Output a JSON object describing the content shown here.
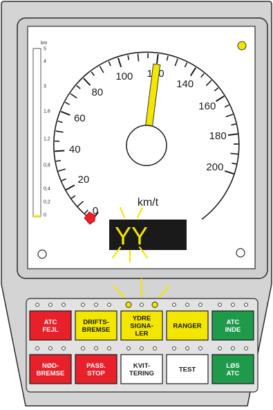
{
  "colors": {
    "panel": "#d4d4d4",
    "screen_bg": "#ffffff",
    "needle": "#f3e600",
    "red": "#e8202a",
    "yellow": "#f3e600",
    "green": "#1f9a4a",
    "white": "#ffffff",
    "display": "#1a1a1a",
    "indicator_glow": "#f3e600"
  },
  "distance_scale": {
    "unit": "km",
    "labels": [
      "5",
      "4",
      "3",
      "1,6",
      "1,2",
      "0,8",
      "0,4",
      "0,2",
      "0"
    ]
  },
  "speedometer": {
    "unit": "km/t",
    "current_speed": 120,
    "min": 0,
    "max": 200,
    "labels": [
      "0",
      "20",
      "40",
      "60",
      "80",
      "100",
      "120",
      "140",
      "160",
      "180",
      "200"
    ]
  },
  "signal_display": {
    "text": "YY"
  },
  "status_lamp": {
    "color": "yellow",
    "state": "on"
  },
  "buttons_row1": [
    {
      "id": "atc-fejl",
      "lines": [
        "ATC",
        "FEJL"
      ],
      "color": "red"
    },
    {
      "id": "driftsbremse",
      "lines": [
        "DRIFTS-",
        "BREMSE"
      ],
      "color": "yellow"
    },
    {
      "id": "ydre-signaler",
      "lines": [
        "YDRE",
        "SIGNA-",
        "LER"
      ],
      "color": "yellow"
    },
    {
      "id": "ranger",
      "lines": [
        "RANGER"
      ],
      "color": "yellow"
    },
    {
      "id": "atc-inde",
      "lines": [
        "ATC",
        "INDE"
      ],
      "color": "green"
    }
  ],
  "buttons_row2": [
    {
      "id": "nodbremse",
      "lines": [
        "NØD-",
        "BREMSE"
      ],
      "color": "red"
    },
    {
      "id": "pass-stop",
      "lines": [
        "PASS.",
        "STOP"
      ],
      "color": "red"
    },
    {
      "id": "kvittering",
      "lines": [
        "KVIT-",
        "TERING"
      ],
      "color": "white"
    },
    {
      "id": "test",
      "lines": [
        "TEST"
      ],
      "color": "white"
    },
    {
      "id": "los-atc",
      "lines": [
        "LØS",
        "ATC"
      ],
      "color": "green"
    }
  ],
  "ydre_signaler_indicators": {
    "state": "lit"
  }
}
